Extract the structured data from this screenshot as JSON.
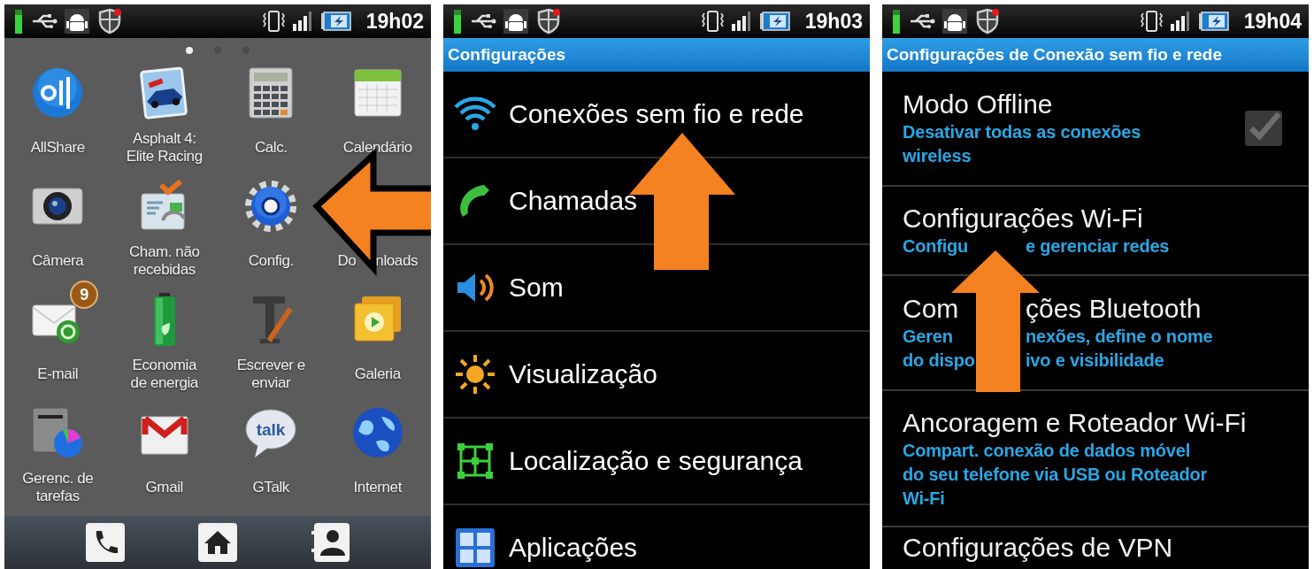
{
  "screens": [
    {
      "kind": "home",
      "status_bar": {
        "time": "19h02"
      },
      "page_dots": [
        {
          "selected": true
        },
        {
          "selected": false
        },
        {
          "selected": false
        }
      ],
      "apps": [
        {
          "label": [
            "AllShare"
          ]
        },
        {
          "label": [
            "Asphalt 4:",
            "Elite Racing"
          ]
        },
        {
          "label": [
            "Calc."
          ]
        },
        {
          "label": [
            "Calendário"
          ]
        },
        {
          "label": [
            "Câmera"
          ]
        },
        {
          "label": [
            "Cham. não",
            "recebidas"
          ]
        },
        {
          "label": [
            "Config."
          ]
        },
        {
          "label": [
            [
              "Do",
              "nloads"
            ]
          ]
        },
        {
          "label": [
            "E-mail"
          ],
          "badge": "9"
        },
        {
          "label": [
            "Economia",
            "de energia"
          ]
        },
        {
          "label": [
            "Escrever e",
            "enviar"
          ]
        },
        {
          "label": [
            "Galeria"
          ]
        },
        {
          "label": [
            "Gerenc. de",
            "tarefas"
          ]
        },
        {
          "label": [
            "Gmail"
          ]
        },
        {
          "label": [
            "GTalk"
          ],
          "icon_text": "talk"
        },
        {
          "label": [
            "Internet"
          ]
        }
      ]
    },
    {
      "kind": "settings",
      "status_bar": {
        "time": "19h03"
      },
      "title": "Configurações",
      "items": [
        {
          "label": "Conexões sem fio e rede"
        },
        {
          "label": "Chamadas"
        },
        {
          "label": "Som"
        },
        {
          "label": "Visualização"
        },
        {
          "label": "Localização e segurança"
        },
        {
          "label": "Aplicações"
        }
      ]
    },
    {
      "kind": "prefs",
      "status_bar": {
        "time": "19h04"
      },
      "title": "Configurações de Conexão sem fio e rede",
      "items": [
        {
          "title": [
            "Modo Offline"
          ],
          "summary": [
            [
              "Desativar todas as conexões"
            ],
            [
              "wireless"
            ]
          ],
          "checkbox": {
            "checked": true,
            "disabled": true
          }
        },
        {
          "title": [
            "Configurações Wi-Fi"
          ],
          "summary": [
            [
              "Configu",
              "e gerenciar redes"
            ]
          ]
        },
        {
          "title": [
            "Com",
            "ções Bluetooth"
          ],
          "summary": [
            [
              "Geren",
              "nexões, define o nome"
            ],
            [
              "do dispo",
              "ivo e visibilidade"
            ]
          ]
        },
        {
          "title": [
            "Ancoragem e Roteador Wi-Fi"
          ],
          "summary": [
            [
              "Compart. conexão de dados móvel"
            ],
            [
              "do seu telefone via USB ou Roteador"
            ],
            [
              "Wi-Fi"
            ]
          ]
        },
        {
          "title": [
            "Configurações de VPN"
          ]
        }
      ]
    }
  ]
}
